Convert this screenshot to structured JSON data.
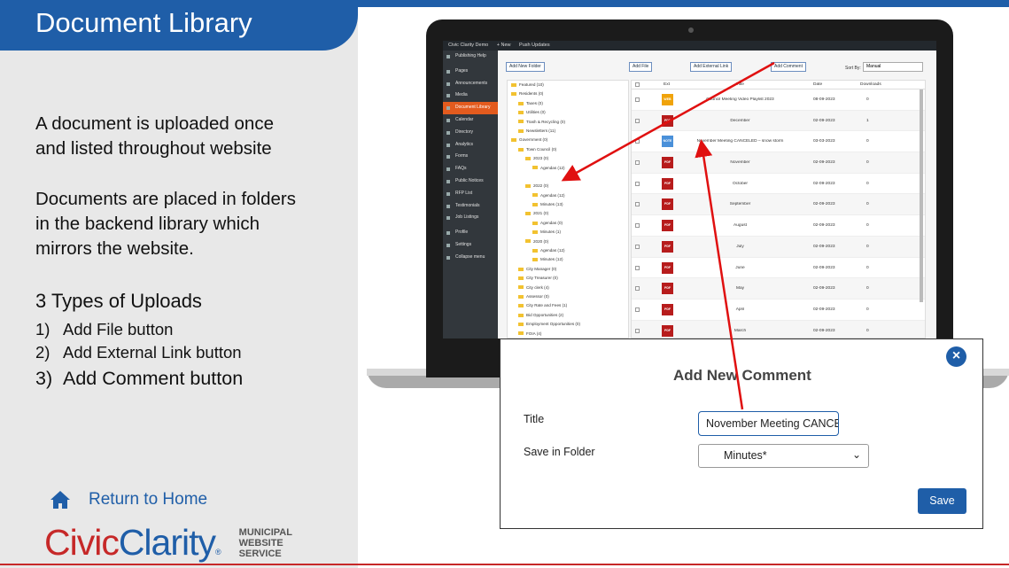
{
  "slide": {
    "title": "Document Library",
    "para1": "A document is uploaded once and listed throughout website",
    "para2": "Documents are placed in folders in the backend library which mirrors the website.",
    "types_title": "3 Types of Uploads",
    "types": [
      {
        "num": "1)",
        "label": "Add File button"
      },
      {
        "num": "2)",
        "label": "Add External Link button"
      },
      {
        "num": "3)",
        "label": "Add Comment button"
      }
    ],
    "home_link": "Return to Home",
    "logo": {
      "civic": "Civic",
      "clarity": "Clarity",
      "reg": "®",
      "tag1": "MUNICIPAL",
      "tag2": "WEBSITE",
      "tag3": "SERVICE"
    },
    "accent": "#1f5ea8",
    "brand_red": "#c62828"
  },
  "admin": {
    "topbar": [
      "Civic Clarity Demo",
      "+ New",
      "Push Updates"
    ],
    "sidebar": [
      "Publishing Help",
      "Pages",
      "Announcements",
      "Media",
      "Document Library",
      "Calendar",
      "Directory",
      "Analytics",
      "Forms",
      "FAQs",
      "Public Notices",
      "RFP List",
      "Testimonials",
      "Job Listings",
      "Profile",
      "Settings",
      "Collapse menu"
    ],
    "buttons": {
      "add_folder": "Add New Folder",
      "add_file": "Add File",
      "add_link": "Add External Link",
      "add_comment": "Add Comment"
    },
    "sort_label": "Sort By:",
    "sort_value": "Manual",
    "tree": [
      {
        "label": "Featured (10)",
        "indent": 0
      },
      {
        "label": "Residents (0)",
        "indent": 0
      },
      {
        "label": "Taxes (0)",
        "indent": 1
      },
      {
        "label": "Utilities (0)",
        "indent": 1
      },
      {
        "label": "Trash & Recycling (0)",
        "indent": 1
      },
      {
        "label": "Newsletters (11)",
        "indent": 1
      },
      {
        "label": "Government (0)",
        "indent": 0
      },
      {
        "label": "Town Council (0)",
        "indent": 1
      },
      {
        "label": "2023 (0)",
        "indent": 2
      },
      {
        "label": "Agendas (12)",
        "indent": 3
      },
      {
        "label": "Minutes (14)",
        "indent": 3,
        "selected": true
      },
      {
        "label": "2022 (0)",
        "indent": 2
      },
      {
        "label": "Agendas (12)",
        "indent": 3
      },
      {
        "label": "Minutes (13)",
        "indent": 3
      },
      {
        "label": "2021 (0)",
        "indent": 2
      },
      {
        "label": "Agendas (0)",
        "indent": 3
      },
      {
        "label": "Minutes (1)",
        "indent": 3
      },
      {
        "label": "2020 (0)",
        "indent": 2
      },
      {
        "label": "Agendas (12)",
        "indent": 3
      },
      {
        "label": "Minutes (12)",
        "indent": 3
      },
      {
        "label": "City Manager (0)",
        "indent": 1
      },
      {
        "label": "City Treasurer (0)",
        "indent": 1
      },
      {
        "label": "City clerk (4)",
        "indent": 1
      },
      {
        "label": "Assessor (0)",
        "indent": 1
      },
      {
        "label": "City Rate and Fees (1)",
        "indent": 1
      },
      {
        "label": "Bid Opportunities (2)",
        "indent": 1
      },
      {
        "label": "Employment Opportunities (0)",
        "indent": 1
      },
      {
        "label": "FOIA (4)",
        "indent": 1
      }
    ],
    "table_headers": {
      "ext": "Ext",
      "title": "Title",
      "date": "Date",
      "downloads": "Downloads"
    },
    "rows": [
      {
        "ext": "WEB",
        "color": "#f0a30a",
        "title": "Council Meeting Video Playlist 2023",
        "date": "08-09-2023",
        "dl": "0"
      },
      {
        "ext": "PDF",
        "color": "#b71c1c",
        "title": "December",
        "date": "02-09-2023",
        "dl": "1"
      },
      {
        "ext": "NOTE",
        "color": "#4a90d9",
        "title": "November Meeting CANCELED – snow storm",
        "date": "03-03-2023",
        "dl": "0"
      },
      {
        "ext": "PDF",
        "color": "#b71c1c",
        "title": "November",
        "date": "02-09-2023",
        "dl": "0"
      },
      {
        "ext": "PDF",
        "color": "#b71c1c",
        "title": "October",
        "date": "02-09-2023",
        "dl": "0"
      },
      {
        "ext": "PDF",
        "color": "#b71c1c",
        "title": "September",
        "date": "02-09-2023",
        "dl": "0"
      },
      {
        "ext": "PDF",
        "color": "#b71c1c",
        "title": "August",
        "date": "02-09-2023",
        "dl": "0"
      },
      {
        "ext": "PDF",
        "color": "#b71c1c",
        "title": "July",
        "date": "02-09-2023",
        "dl": "0"
      },
      {
        "ext": "PDF",
        "color": "#b71c1c",
        "title": "June",
        "date": "02-09-2023",
        "dl": "0"
      },
      {
        "ext": "PDF",
        "color": "#b71c1c",
        "title": "May",
        "date": "02-09-2023",
        "dl": "0"
      },
      {
        "ext": "PDF",
        "color": "#b71c1c",
        "title": "April",
        "date": "02-09-2023",
        "dl": "0"
      },
      {
        "ext": "PDF",
        "color": "#b71c1c",
        "title": "March",
        "date": "02-09-2023",
        "dl": "0"
      }
    ]
  },
  "modal": {
    "title": "Add New Comment",
    "close": "×",
    "title_label": "Title",
    "title_value": "November Meeting CANCELED – snow storm",
    "folder_label": "Save in Folder",
    "folder_value": "Minutes*",
    "save": "Save"
  }
}
